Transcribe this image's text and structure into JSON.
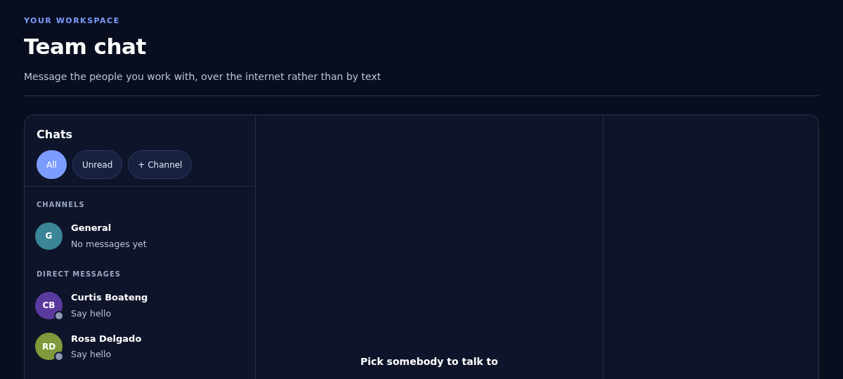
{
  "header": {
    "eyebrow": "YOUR WORKSPACE",
    "title": "Team chat",
    "subtitle": "Message the people you work with, over the internet rather than by text"
  },
  "sidebar": {
    "title": "Chats",
    "filters": [
      {
        "label": "All",
        "selected": true
      },
      {
        "label": "Unread",
        "selected": false
      },
      {
        "label": "+ Channel",
        "selected": false
      }
    ],
    "sections": [
      {
        "heading": "CHANNELS",
        "items": [
          {
            "initials": "G",
            "name": "General",
            "preview": "No messages yet",
            "color": "#3a8696"
          }
        ]
      },
      {
        "heading": "DIRECT MESSAGES",
        "items": [
          {
            "initials": "CB",
            "name": "Curtis Boateng",
            "preview": "Say hello",
            "color": "#5b3a9e",
            "online": false
          },
          {
            "initials": "RD",
            "name": "Rosa Delgado",
            "preview": "Say hello",
            "color": "#7e9a3a",
            "online": false
          }
        ]
      }
    ]
  },
  "conversation": {
    "empty_text": "Pick somebody to talk to"
  }
}
